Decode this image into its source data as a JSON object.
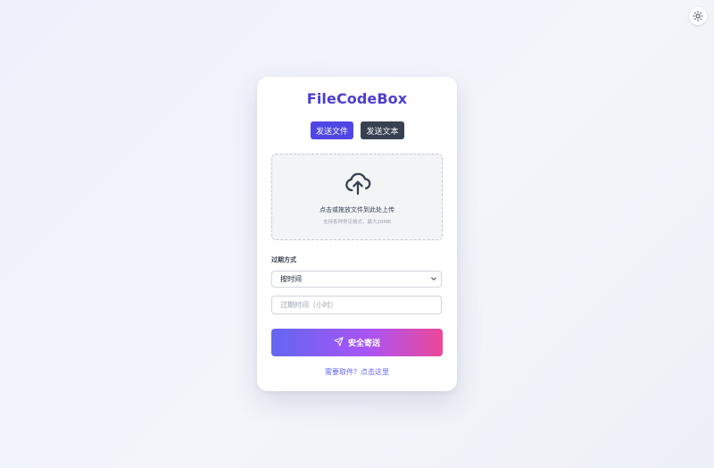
{
  "app": {
    "title": "FileCodeBox"
  },
  "theme_toggle": {
    "icon": "sun-icon"
  },
  "tabs": [
    {
      "label": "发送文件",
      "active": true,
      "color": "#4f46e5"
    },
    {
      "label": "发送文本",
      "active": false,
      "color": "#374151"
    }
  ],
  "upload": {
    "icon": "cloud-upload-icon",
    "main_text": "点击或拖放文件到此处上传",
    "sub_text": "支持各种常见格式，最大20MB"
  },
  "expiration": {
    "label": "过期方式",
    "selected": "按时间",
    "input_placeholder": "过期时间（小时）",
    "input_value": ""
  },
  "submit": {
    "label": "安全寄送",
    "icon": "send-icon"
  },
  "retrieve_link": {
    "label": "需要取件？点击这里"
  },
  "colors": {
    "brand": "#4b3fd1",
    "gradient_start": "#6366f1",
    "gradient_end": "#ec4899",
    "link": "#6366f1"
  }
}
